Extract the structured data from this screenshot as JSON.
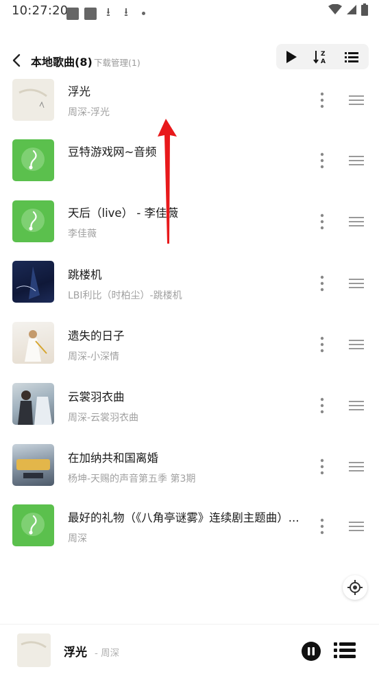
{
  "status_bar": {
    "time": "10:27:20"
  },
  "header": {
    "title": "本地歌曲(8)",
    "subtitle": "下载管理(1)"
  },
  "toolbar": {
    "icons": [
      "play-icon",
      "sort-az-icon",
      "list-menu-icon"
    ]
  },
  "songs": [
    {
      "title": "浮光",
      "subtitle": "周深-浮光",
      "cover": "cover-cream"
    },
    {
      "title": "豆特游戏网~音频",
      "subtitle": "",
      "cover": "cover-green"
    },
    {
      "title": "天后（live） - 李佳薇",
      "subtitle": "李佳薇",
      "cover": "cover-green"
    },
    {
      "title": "跳楼机",
      "subtitle": "LBI利比（时柏尘）-跳楼机",
      "cover": "cover-dark"
    },
    {
      "title": "遗失的日子",
      "subtitle": "周深-小深情",
      "cover": "cover-light"
    },
    {
      "title": "云裳羽衣曲",
      "subtitle": "周深-云裳羽衣曲",
      "cover": "cover-blue"
    },
    {
      "title": "在加纳共和国离婚",
      "subtitle": "杨坤-天赐的声音第五季 第3期",
      "cover": "cover-show"
    },
    {
      "title": "最好的礼物（《八角亭谜雾》连续剧主题曲）...",
      "subtitle": "周深",
      "cover": "cover-green"
    }
  ],
  "player": {
    "title": "浮光",
    "artist": "- 周深"
  },
  "colors": {
    "accent_green": "#5bc04d",
    "swipe_arrow": "#e8191b"
  }
}
